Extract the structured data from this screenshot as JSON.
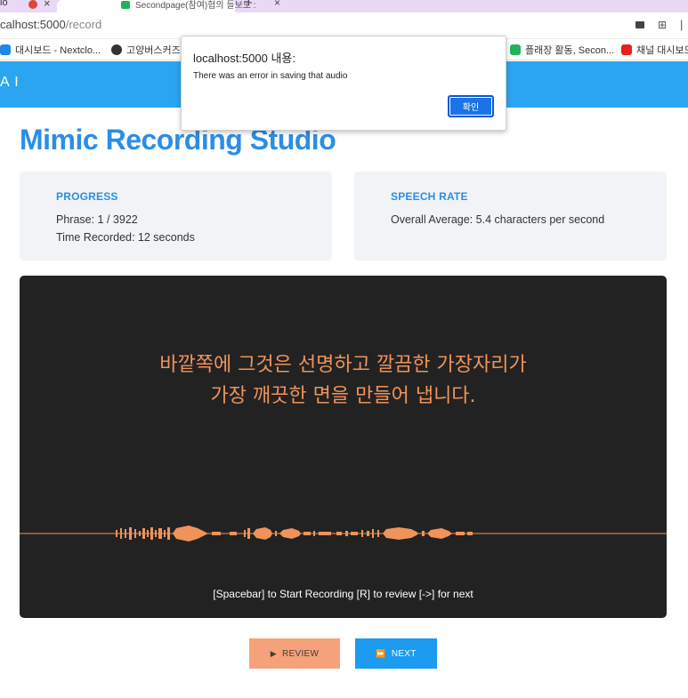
{
  "browser": {
    "tab_fragment": "io",
    "active_tab_title": "Secondpage(참여)협의 들보도 :",
    "url_host": "calhost:5000",
    "url_path": "/record",
    "bookmarks": [
      {
        "label": "대시보드 - Nextclo...",
        "color": "#1e88e5"
      },
      {
        "label": "고양버스커즈",
        "color": "#333333"
      },
      {
        "label": "플래장 활동, Secon...",
        "color": "#21b25a"
      },
      {
        "label": "채널 대시보드",
        "color": "#e62117"
      }
    ]
  },
  "app": {
    "brand": "A I",
    "title": "Mimic Recording Studio"
  },
  "progress": {
    "heading": "PROGRESS",
    "phrase": "Phrase: 1 / 3922",
    "time_recorded": "Time Recorded: 12 seconds"
  },
  "speech_rate": {
    "heading": "SPEECH RATE",
    "average": "Overall Average: 5.4 characters per second"
  },
  "stage": {
    "phrase_line1": "바깥쪽에 그것은 선명하고 깔끔한 가장자리가",
    "phrase_line2": "가장 깨끗한 면을 만들어 냅니다.",
    "hint": "[Spacebar] to Start Recording [R] to review [->] for next",
    "wave_color": "#f0935a"
  },
  "buttons": {
    "review": "REVIEW",
    "next": "NEXT"
  },
  "alert": {
    "title": "localhost:5000 내용:",
    "message": "There was an error in saving that audio",
    "ok": "확인"
  }
}
